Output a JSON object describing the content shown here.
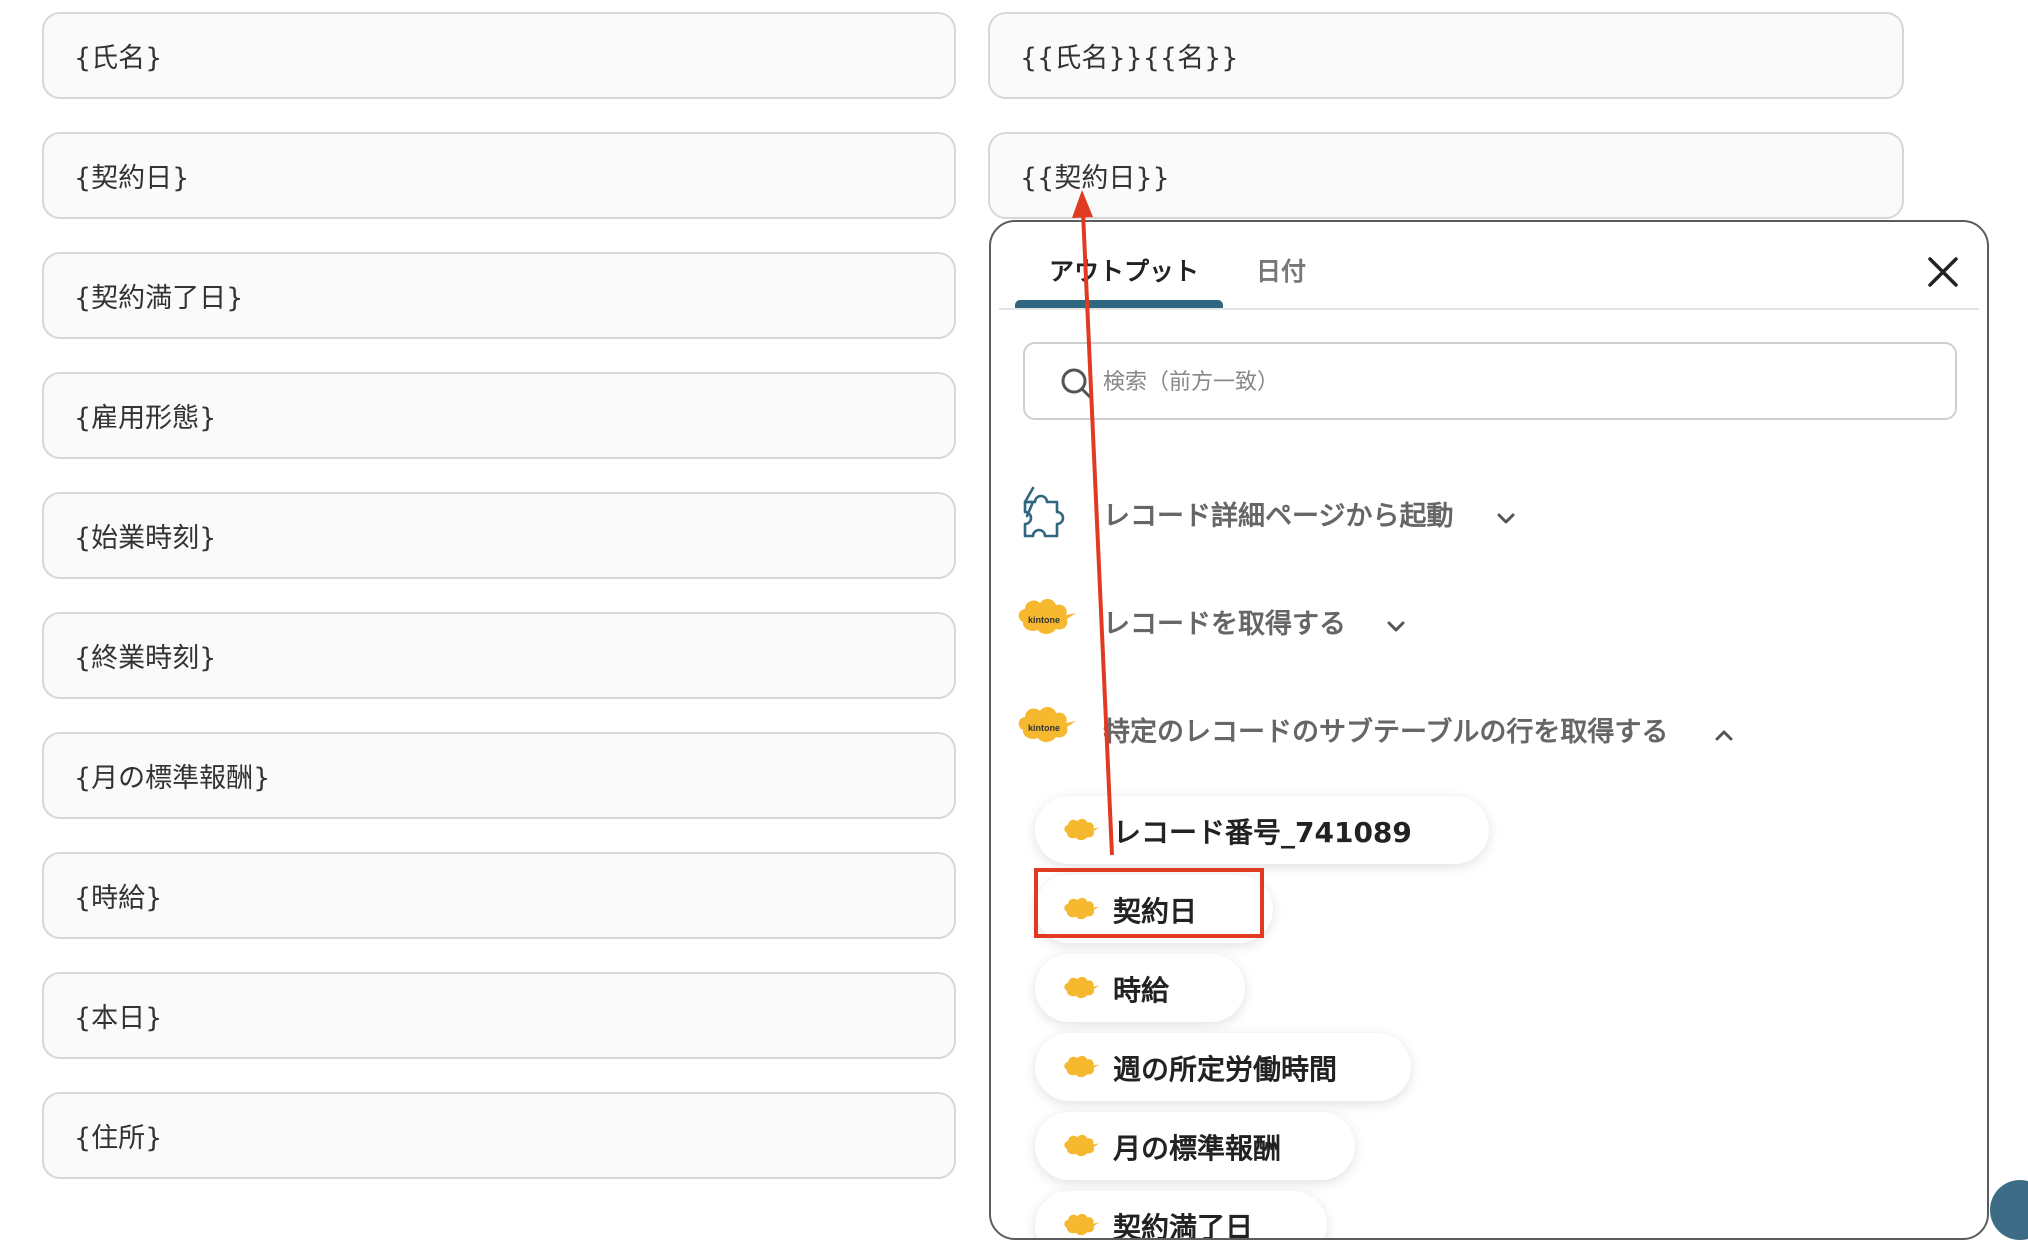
{
  "left_fields": [
    {
      "value": "{氏名}"
    },
    {
      "value": "{契約日}"
    },
    {
      "value": "{契約満了日}"
    },
    {
      "value": "{雇用形態}"
    },
    {
      "value": "{始業時刻}"
    },
    {
      "value": "{終業時刻}"
    },
    {
      "value": "{月の標準報酬}"
    },
    {
      "value": "{時給}"
    },
    {
      "value": "{本日}"
    },
    {
      "value": "{住所}"
    }
  ],
  "right_fields": [
    {
      "value": "{{氏名}}{{名}}"
    },
    {
      "value": "{{契約日}}"
    }
  ],
  "panel": {
    "tabs": [
      {
        "label": "アウトプット",
        "active": true
      },
      {
        "label": "日付",
        "active": false
      }
    ],
    "search": {
      "placeholder": "検索（前方一致）"
    },
    "sections": [
      {
        "label": "レコード詳細ページから起動",
        "icon": "puzzle-bolt-icon",
        "expanded": false
      },
      {
        "label": "レコードを取得する",
        "icon": "kintone-logo-icon",
        "expanded": false
      },
      {
        "label": "特定のレコードのサブテーブルの行を取得する",
        "icon": "kintone-logo-icon",
        "expanded": true
      }
    ],
    "items": [
      {
        "label": "レコード番号_741089"
      },
      {
        "label": "契約日",
        "highlighted": true
      },
      {
        "label": "時給"
      },
      {
        "label": "週の所定労働時間"
      },
      {
        "label": "月の標準報酬"
      },
      {
        "label": "契約満了日"
      }
    ],
    "logo_text": "kintone"
  },
  "colors": {
    "accent_tab": "#2f6780",
    "annotation_red": "#e03a22",
    "kintone_yellow": "#f5b82e"
  }
}
